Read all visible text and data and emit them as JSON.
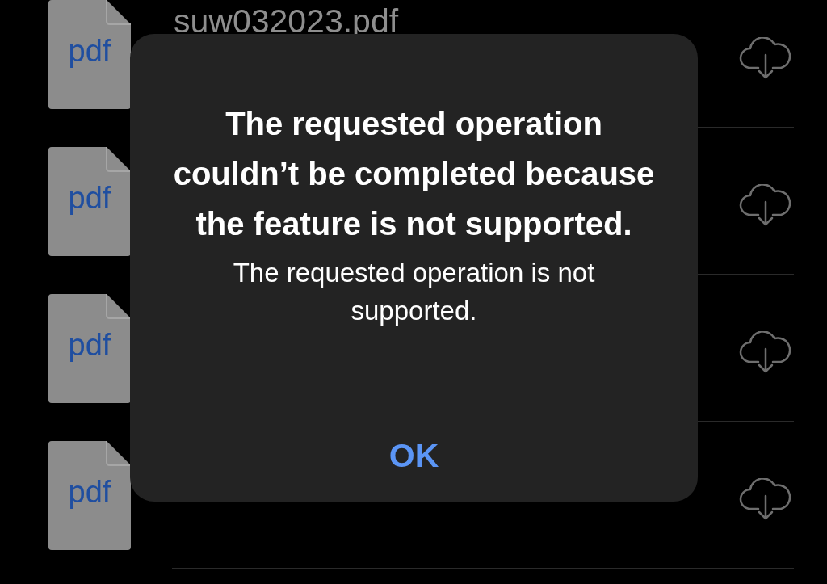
{
  "files": [
    {
      "icon_label": "pdf",
      "name": "suw032023.pdf"
    },
    {
      "icon_label": "pdf"
    },
    {
      "icon_label": "pdf"
    },
    {
      "icon_label": "pdf"
    }
  ],
  "alert": {
    "title": "The requested operation couldn’t be completed because the feature is not supported.",
    "message": "The requested operation is not supported.",
    "buttons": [
      "OK"
    ]
  }
}
